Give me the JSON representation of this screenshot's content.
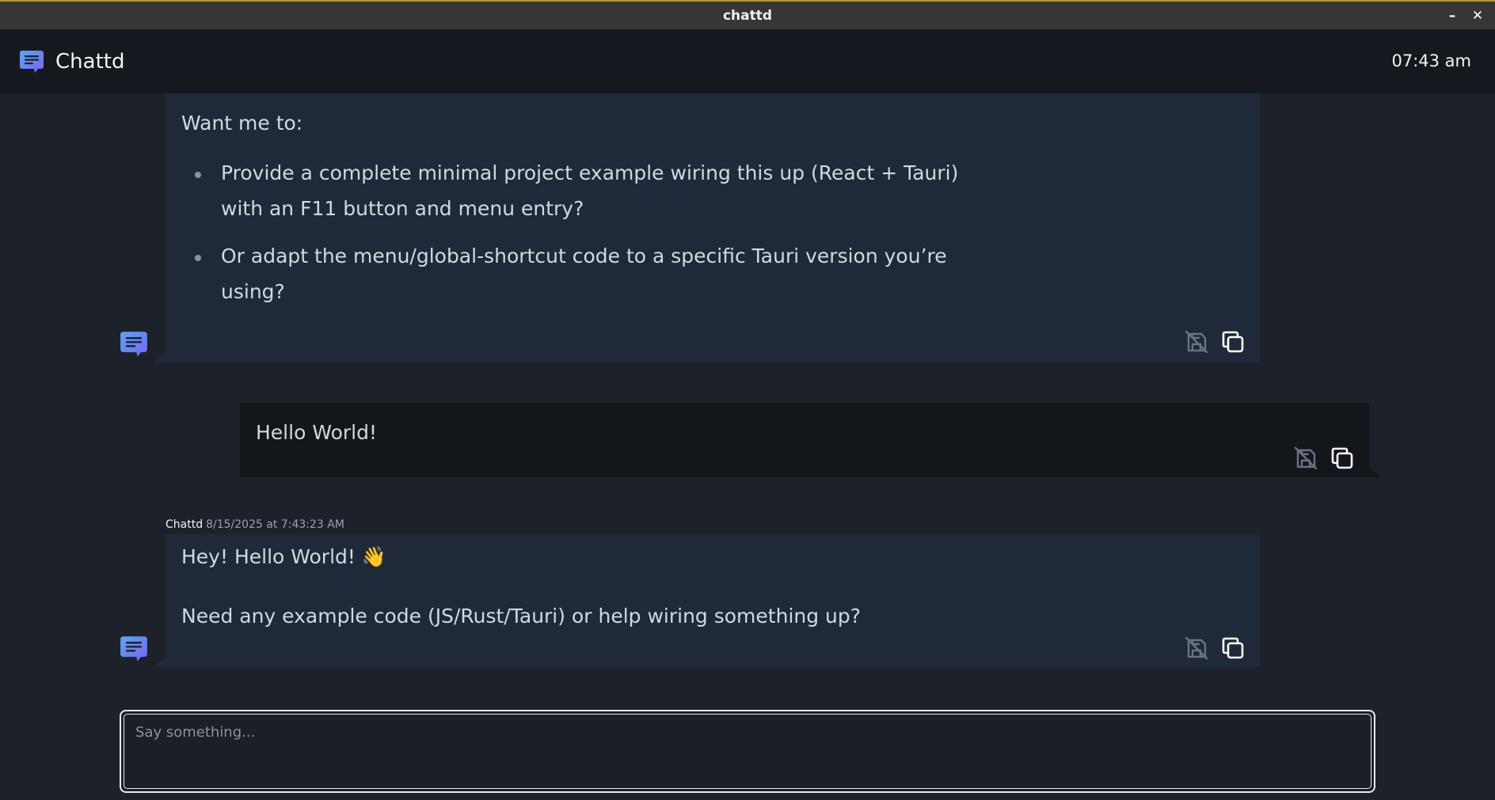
{
  "window": {
    "title": "chattd",
    "minimize_label": "–",
    "close_label": "✕"
  },
  "header": {
    "app_name": "Chattd",
    "clock": "07:43 am"
  },
  "messages": [
    {
      "role": "assistant",
      "intro": "Want me to:",
      "bullets": [
        "Provide a complete minimal project example wiring this up (React + Tauri) with an F11 button and menu entry?",
        "Or adapt the menu/global-shortcut code to a specific Tauri version you’re using?"
      ]
    },
    {
      "role": "user",
      "text": "Hello World!"
    },
    {
      "role": "assistant",
      "sender": "Chattd",
      "timestamp": "8/15/2025 at 7:43:23 AM",
      "line1": "Hey! Hello World! 👋",
      "line2": "Need any example code (JS/Rust/Tauri) or help wiring something up?"
    }
  ],
  "composer": {
    "placeholder": "Say something..."
  },
  "colors": {
    "accent": "#6c7cf4",
    "assistant_bubble": "#1f293a",
    "user_bubble": "#13161b",
    "background": "#1d2129",
    "header": "#15191f"
  },
  "icons": [
    "chat-logo-icon",
    "no-save-icon",
    "copy-icon"
  ]
}
